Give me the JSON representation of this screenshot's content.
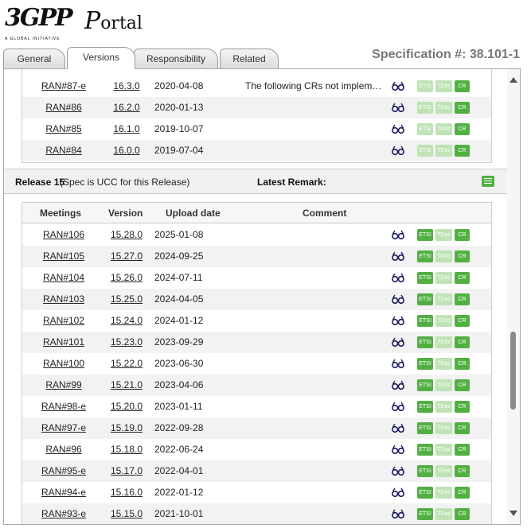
{
  "header": {
    "logo_mark": "3GPP",
    "logo_tagline": "A GLOBAL INITIATIVE",
    "portal_first": "P",
    "portal_rest": "ortal",
    "spec_title": "Specification #: 38.101-1"
  },
  "tabs": [
    {
      "label": "General",
      "active": false
    },
    {
      "label": "Versions",
      "active": true
    },
    {
      "label": "Responsibility",
      "active": false
    },
    {
      "label": "Related",
      "active": false
    }
  ],
  "badges": {
    "etsi": "ETSI",
    "tdoc": "TDoc",
    "cr": "CR"
  },
  "previous_release_rows": [
    {
      "meeting": "RAN#87-e",
      "version": "16.3.0",
      "date": "2020-04-08",
      "comment": "The following CRs not impleme…",
      "etsi_active": false
    },
    {
      "meeting": "RAN#86",
      "version": "16.2.0",
      "date": "2020-01-13",
      "comment": "",
      "etsi_active": false
    },
    {
      "meeting": "RAN#85",
      "version": "16.1.0",
      "date": "2019-10-07",
      "comment": "",
      "etsi_active": false
    },
    {
      "meeting": "RAN#84",
      "version": "16.0.0",
      "date": "2019-07-04",
      "comment": "",
      "etsi_active": false
    }
  ],
  "release": {
    "title": "Release 15",
    "note": "(Spec is UCC for this Release)",
    "remark_label": "Latest Remark:"
  },
  "columns": {
    "meetings": "Meetings",
    "version": "Version",
    "upload_date": "Upload date",
    "comment": "Comment"
  },
  "release15_rows": [
    {
      "meeting": "RAN#106",
      "version": "15.28.0",
      "date": "2025-01-08",
      "comment": ""
    },
    {
      "meeting": "RAN#105",
      "version": "15.27.0",
      "date": "2024-09-25",
      "comment": ""
    },
    {
      "meeting": "RAN#104",
      "version": "15.26.0",
      "date": "2024-07-11",
      "comment": ""
    },
    {
      "meeting": "RAN#103",
      "version": "15.25.0",
      "date": "2024-04-05",
      "comment": ""
    },
    {
      "meeting": "RAN#102",
      "version": "15.24.0",
      "date": "2024-01-12",
      "comment": ""
    },
    {
      "meeting": "RAN#101",
      "version": "15.23.0",
      "date": "2023-09-29",
      "comment": ""
    },
    {
      "meeting": "RAN#100",
      "version": "15.22.0",
      "date": "2023-06-30",
      "comment": ""
    },
    {
      "meeting": "RAN#99",
      "version": "15.21.0",
      "date": "2023-04-06",
      "comment": ""
    },
    {
      "meeting": "RAN#98-e",
      "version": "15.20.0",
      "date": "2023-01-11",
      "comment": ""
    },
    {
      "meeting": "RAN#97-e",
      "version": "15.19.0",
      "date": "2022-09-28",
      "comment": ""
    },
    {
      "meeting": "RAN#96",
      "version": "15.18.0",
      "date": "2022-06-24",
      "comment": ""
    },
    {
      "meeting": "RAN#95-e",
      "version": "15.17.0",
      "date": "2022-04-01",
      "comment": ""
    },
    {
      "meeting": "RAN#94-e",
      "version": "15.16.0",
      "date": "2022-01-12",
      "comment": ""
    },
    {
      "meeting": "RAN#93-e",
      "version": "15.15.0",
      "date": "2021-10-01",
      "comment": ""
    }
  ],
  "icons": {
    "view": "glasses-icon",
    "remark": "comment-icon",
    "scroll_up": "chevron-up-icon",
    "scroll_down": "chevron-down-icon"
  },
  "colors": {
    "badge_active": "#52b043",
    "badge_dim": "#bfe3b5",
    "spec_title": "#777777"
  }
}
